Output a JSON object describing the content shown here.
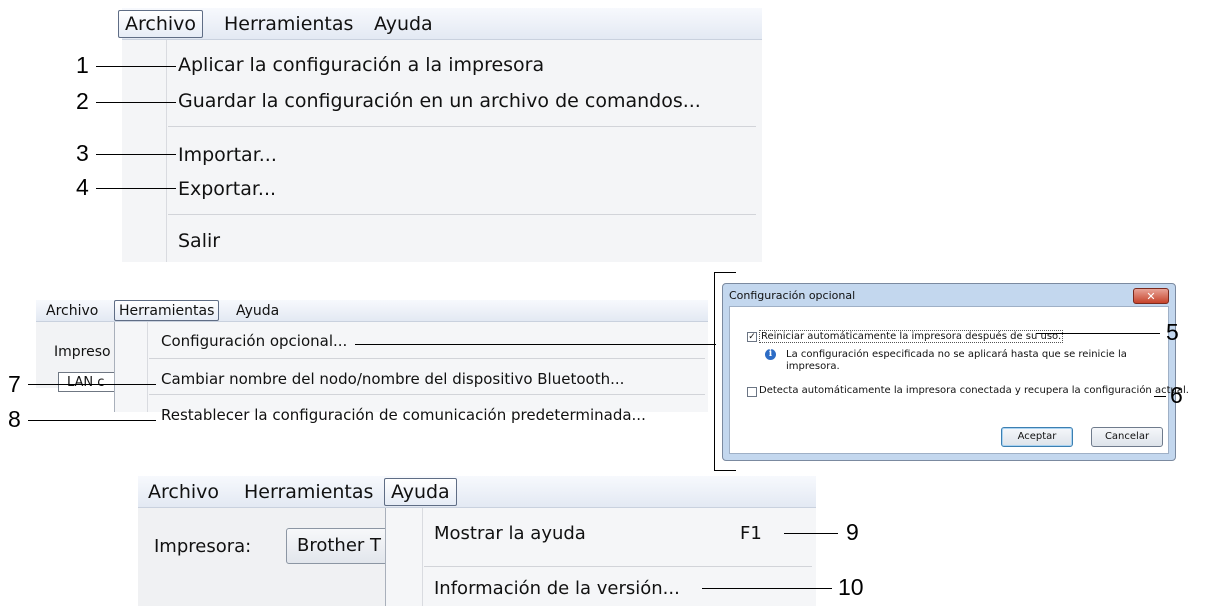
{
  "menubar": {
    "archivo": "Archivo",
    "herramientas": "Herramientas",
    "ayuda": "Ayuda"
  },
  "archivo_menu": {
    "items": [
      "Aplicar la configuración a la impresora",
      "Guardar la configuración en un archivo de comandos...",
      "Importar...",
      "Exportar...",
      "Salir"
    ]
  },
  "herramientas_menu": {
    "items": [
      "Configuración opcional...",
      "Cambiar nombre del nodo/nombre del dispositivo Bluetooth...",
      "Restablecer la configuración de comunicación predeterminada..."
    ],
    "behind_label": "Impreso",
    "behind_field": "LAN c"
  },
  "dialog": {
    "title": "Configuración opcional",
    "close_label": "✕",
    "option1_label": "Reiniciar automáticamente la impresora después de su uso.",
    "option1_checked": true,
    "info_text_line1": "La configuración especificada no se aplicará hasta que se reinicie la",
    "info_text_line2": "impresora.",
    "option2_label": "Detecta automáticamente la impresora conectada y recupera la configuración actual.",
    "option2_checked": false,
    "ok_label": "Aceptar",
    "cancel_label": "Cancelar"
  },
  "ayuda_menu": {
    "items": [
      "Mostrar la ayuda",
      "Información de la versión..."
    ],
    "shortcut": "F1",
    "printer_label": "Impresora:",
    "printer_value": "Brother T"
  },
  "callouts": [
    "1",
    "2",
    "3",
    "4",
    "5",
    "6",
    "7",
    "8",
    "9",
    "10"
  ]
}
